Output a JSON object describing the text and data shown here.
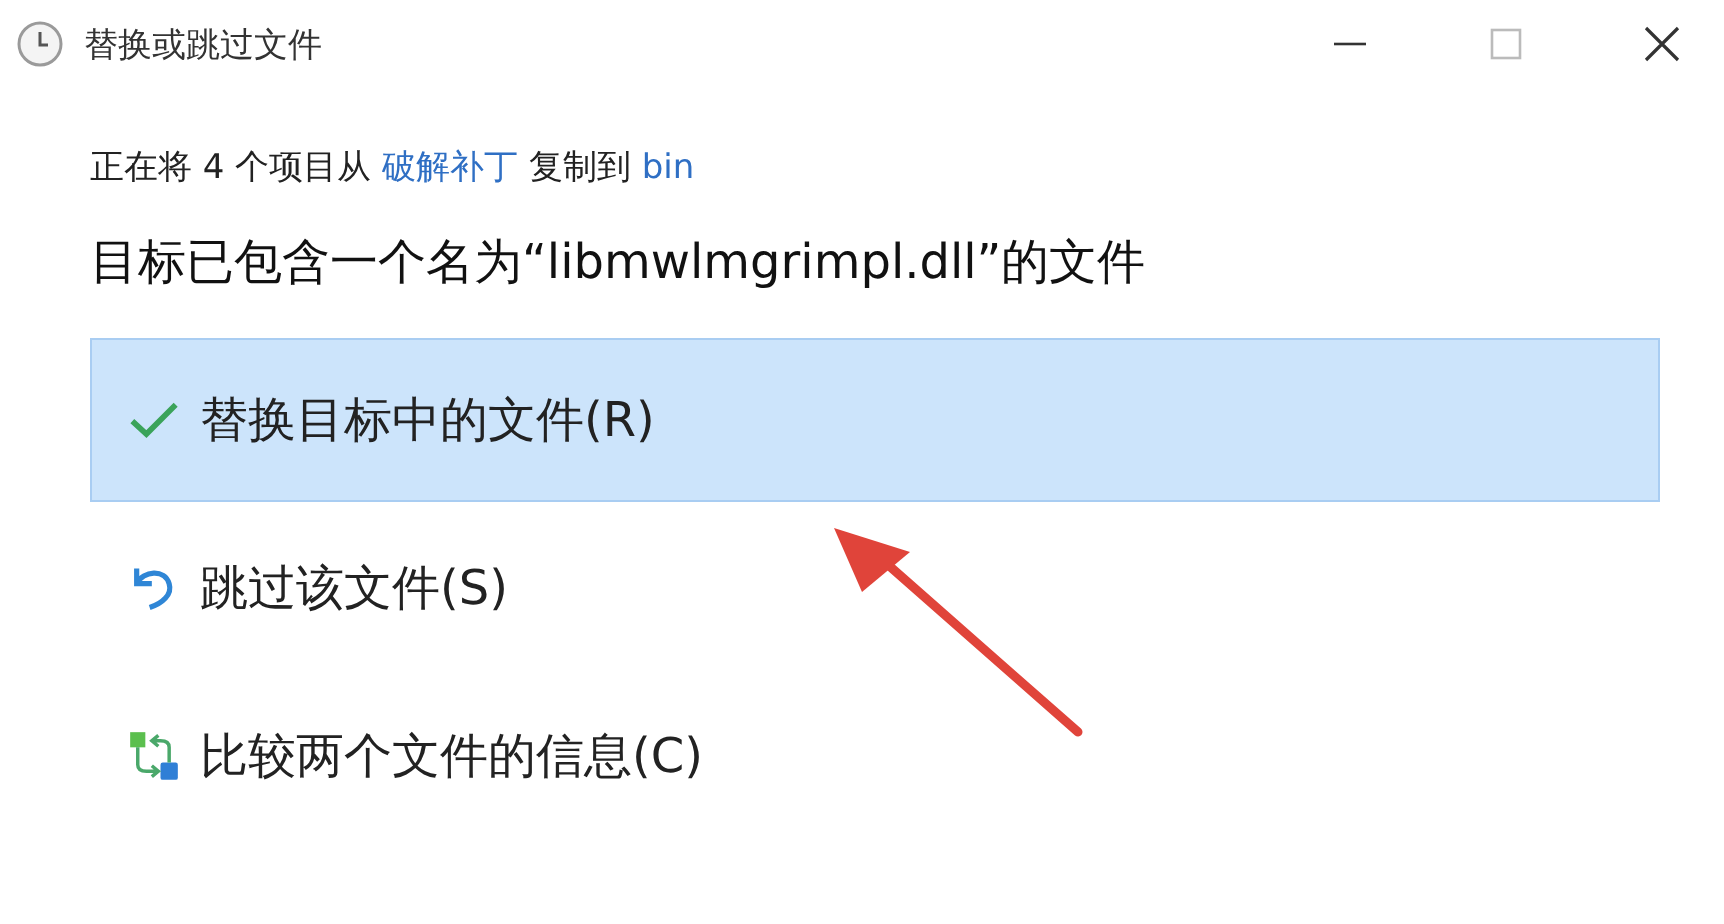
{
  "window": {
    "title": "替换或跳过文件"
  },
  "copy_line": {
    "parts": [
      {
        "kind": "text",
        "text": "正在将 4 个项目从 "
      },
      {
        "kind": "link",
        "text": "破解补丁"
      },
      {
        "kind": "text",
        "text": " 复制到 "
      },
      {
        "kind": "link",
        "text": "bin"
      }
    ]
  },
  "heading": "目标已包含一个名为“libmwlmgrimpl.dll”的文件",
  "options": [
    {
      "kind": "replace",
      "label": "替换目标中的文件(R)",
      "selected": true
    },
    {
      "kind": "skip",
      "label": "跳过该文件(S)",
      "selected": false
    },
    {
      "kind": "compare",
      "label": "比较两个文件的信息(C)",
      "selected": false
    }
  ]
}
